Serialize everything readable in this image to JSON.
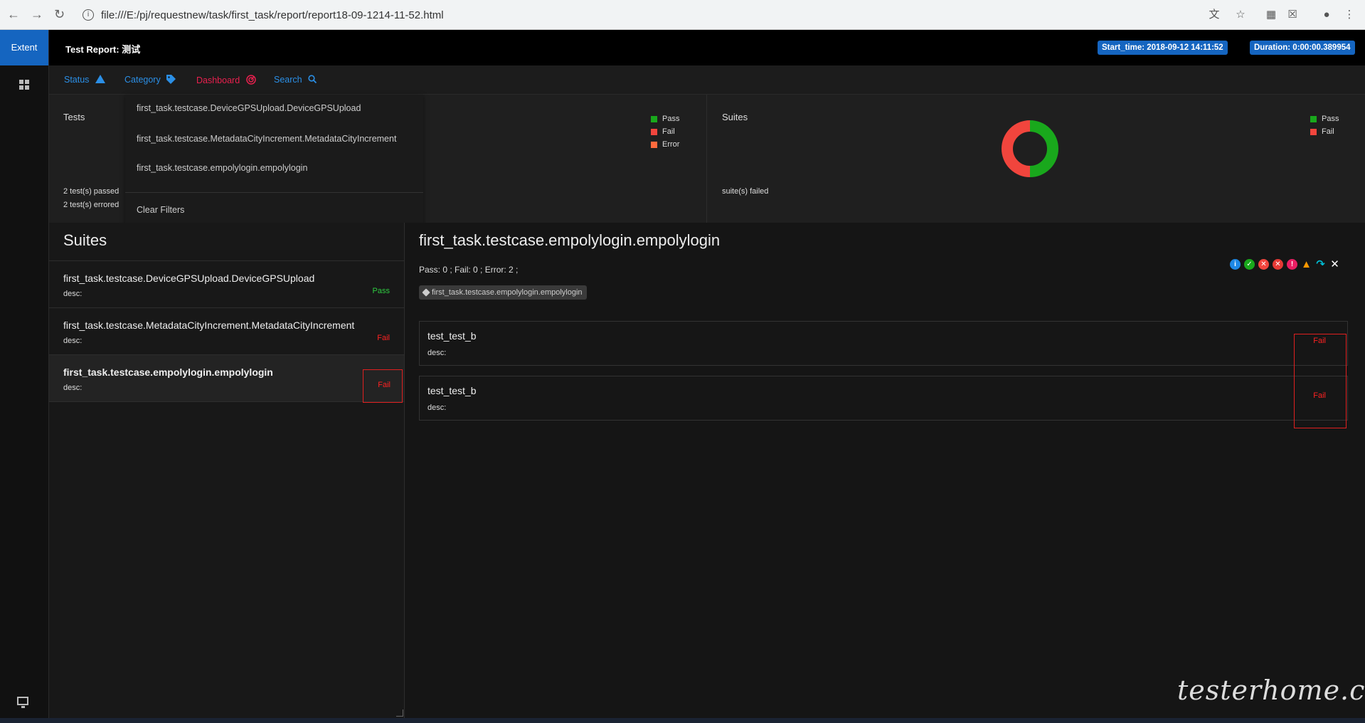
{
  "browser": {
    "url": "file:///E:/pj/requestnew/task/first_task/report/report18-09-1214-11-52.html"
  },
  "sidebar": {
    "brand": "Extent"
  },
  "header": {
    "title": "Test Report: 测试",
    "start_time": "Start_time: 2018-09-12 14:11:52",
    "duration": "Duration: 0:00:00.389954"
  },
  "filters": {
    "status": "Status",
    "category": "Category",
    "dashboard": "Dashboard",
    "search": "Search",
    "colors": {
      "status": "#2b8fe6",
      "category": "#2b8fe6",
      "dashboard": "#e8204e",
      "search": "#2b8fe6"
    }
  },
  "dropdown": {
    "items": [
      "first_task.testcase.DeviceGPSUpload.DeviceGPSUpload",
      "first_task.testcase.MetadataCityIncrement.MetadataCityIncrement",
      "first_task.testcase.empolylogin.empolylogin"
    ],
    "clear": "Clear Filters"
  },
  "tests_panel": {
    "title": "Tests",
    "passed": "2 test(s) passed",
    "errored": "2 test(s) errored",
    "legend": [
      {
        "label": "Pass",
        "color": "#19a81c"
      },
      {
        "label": "Fail",
        "color": "#f1453d"
      },
      {
        "label": "Error",
        "color": "#ff6a3d"
      }
    ]
  },
  "suites_panel": {
    "title": "Suites",
    "failed": "suite(s) failed",
    "legend": [
      {
        "label": "Pass",
        "color": "#19a81c"
      },
      {
        "label": "Fail",
        "color": "#f1453d"
      }
    ],
    "donut": {
      "pass_fraction": 0.5,
      "fail_fraction": 0.5
    }
  },
  "suites": {
    "title": "Suites",
    "items": [
      {
        "name": "first_task.testcase.DeviceGPSUpload.DeviceGPSUpload",
        "desc": "desc:",
        "status": "Pass"
      },
      {
        "name": "first_task.testcase.MetadataCityIncrement.MetadataCityIncrement",
        "desc": "desc:",
        "status": "Fail"
      },
      {
        "name": "first_task.testcase.empolylogin.empolylogin",
        "desc": "desc:",
        "status": "Fail"
      }
    ]
  },
  "detail": {
    "title": "first_task.testcase.empolylogin.empolylogin",
    "counts": "Pass: 0 ; Fail: 0 ; Error: 2 ;",
    "tag": "first_task.testcase.empolylogin.empolylogin",
    "tests": [
      {
        "name": "test_test_b",
        "desc": "desc:",
        "status": "Fail"
      },
      {
        "name": "test_test_b",
        "desc": "desc:",
        "status": "Fail"
      }
    ]
  },
  "watermark": "testerhome.com"
}
